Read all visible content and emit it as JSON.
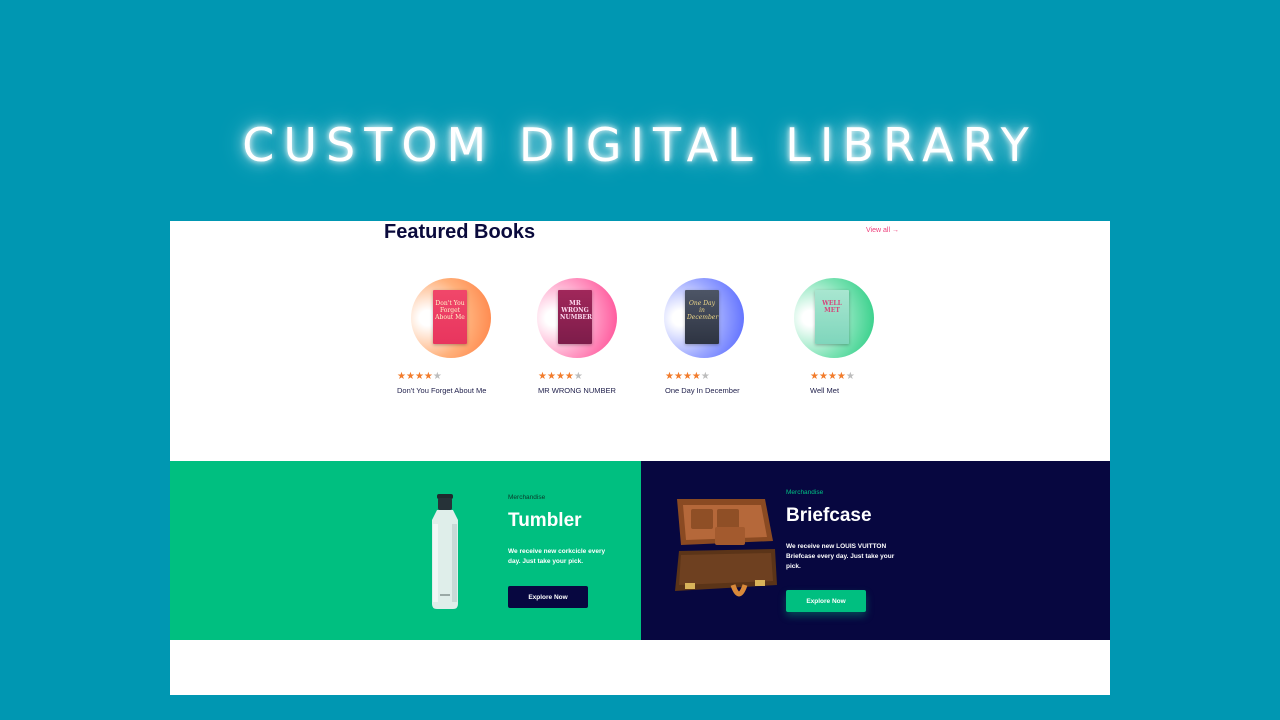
{
  "hero": {
    "title": "CUSTOM DIGITAL LIBRARY"
  },
  "featured": {
    "heading": "Featured Books",
    "view_all": "View all →",
    "books": [
      {
        "title": "Don't You Forget About Me",
        "rating": 4,
        "max_rating": 5,
        "cover_text": "Don't You Forget About Me",
        "accent": "#ff7a3d"
      },
      {
        "title": "MR WRONG NUMBER",
        "rating": 4,
        "max_rating": 5,
        "cover_text": "MR WRONG NUMBER",
        "accent": "#ff3d8b"
      },
      {
        "title": "One Day In December",
        "rating": 4,
        "max_rating": 5,
        "cover_text": "One Day in December",
        "accent": "#4a5cff"
      },
      {
        "title": "Well Met",
        "rating": 4,
        "max_rating": 5,
        "cover_text": "WELL MET",
        "accent": "#1cc97a"
      }
    ]
  },
  "promos": [
    {
      "tag": "Merchandise",
      "title": "Tumbler",
      "description": "We receive new corkcicle every day. Just take your pick.",
      "button": "Explore Now",
      "background": "#00bf80",
      "button_color": "#070740"
    },
    {
      "tag": "Merchandise",
      "title": "Briefcase",
      "description": "We receive new LOUIS VUITTON Briefcase every day. Just take your pick.",
      "button": "Explore Now",
      "background": "#070740",
      "button_color": "#00bf80"
    }
  ],
  "colors": {
    "page_background": "#0097b2",
    "heading": "#0a0a3c",
    "link": "#ee3d7a",
    "star": "#f27c2c"
  }
}
